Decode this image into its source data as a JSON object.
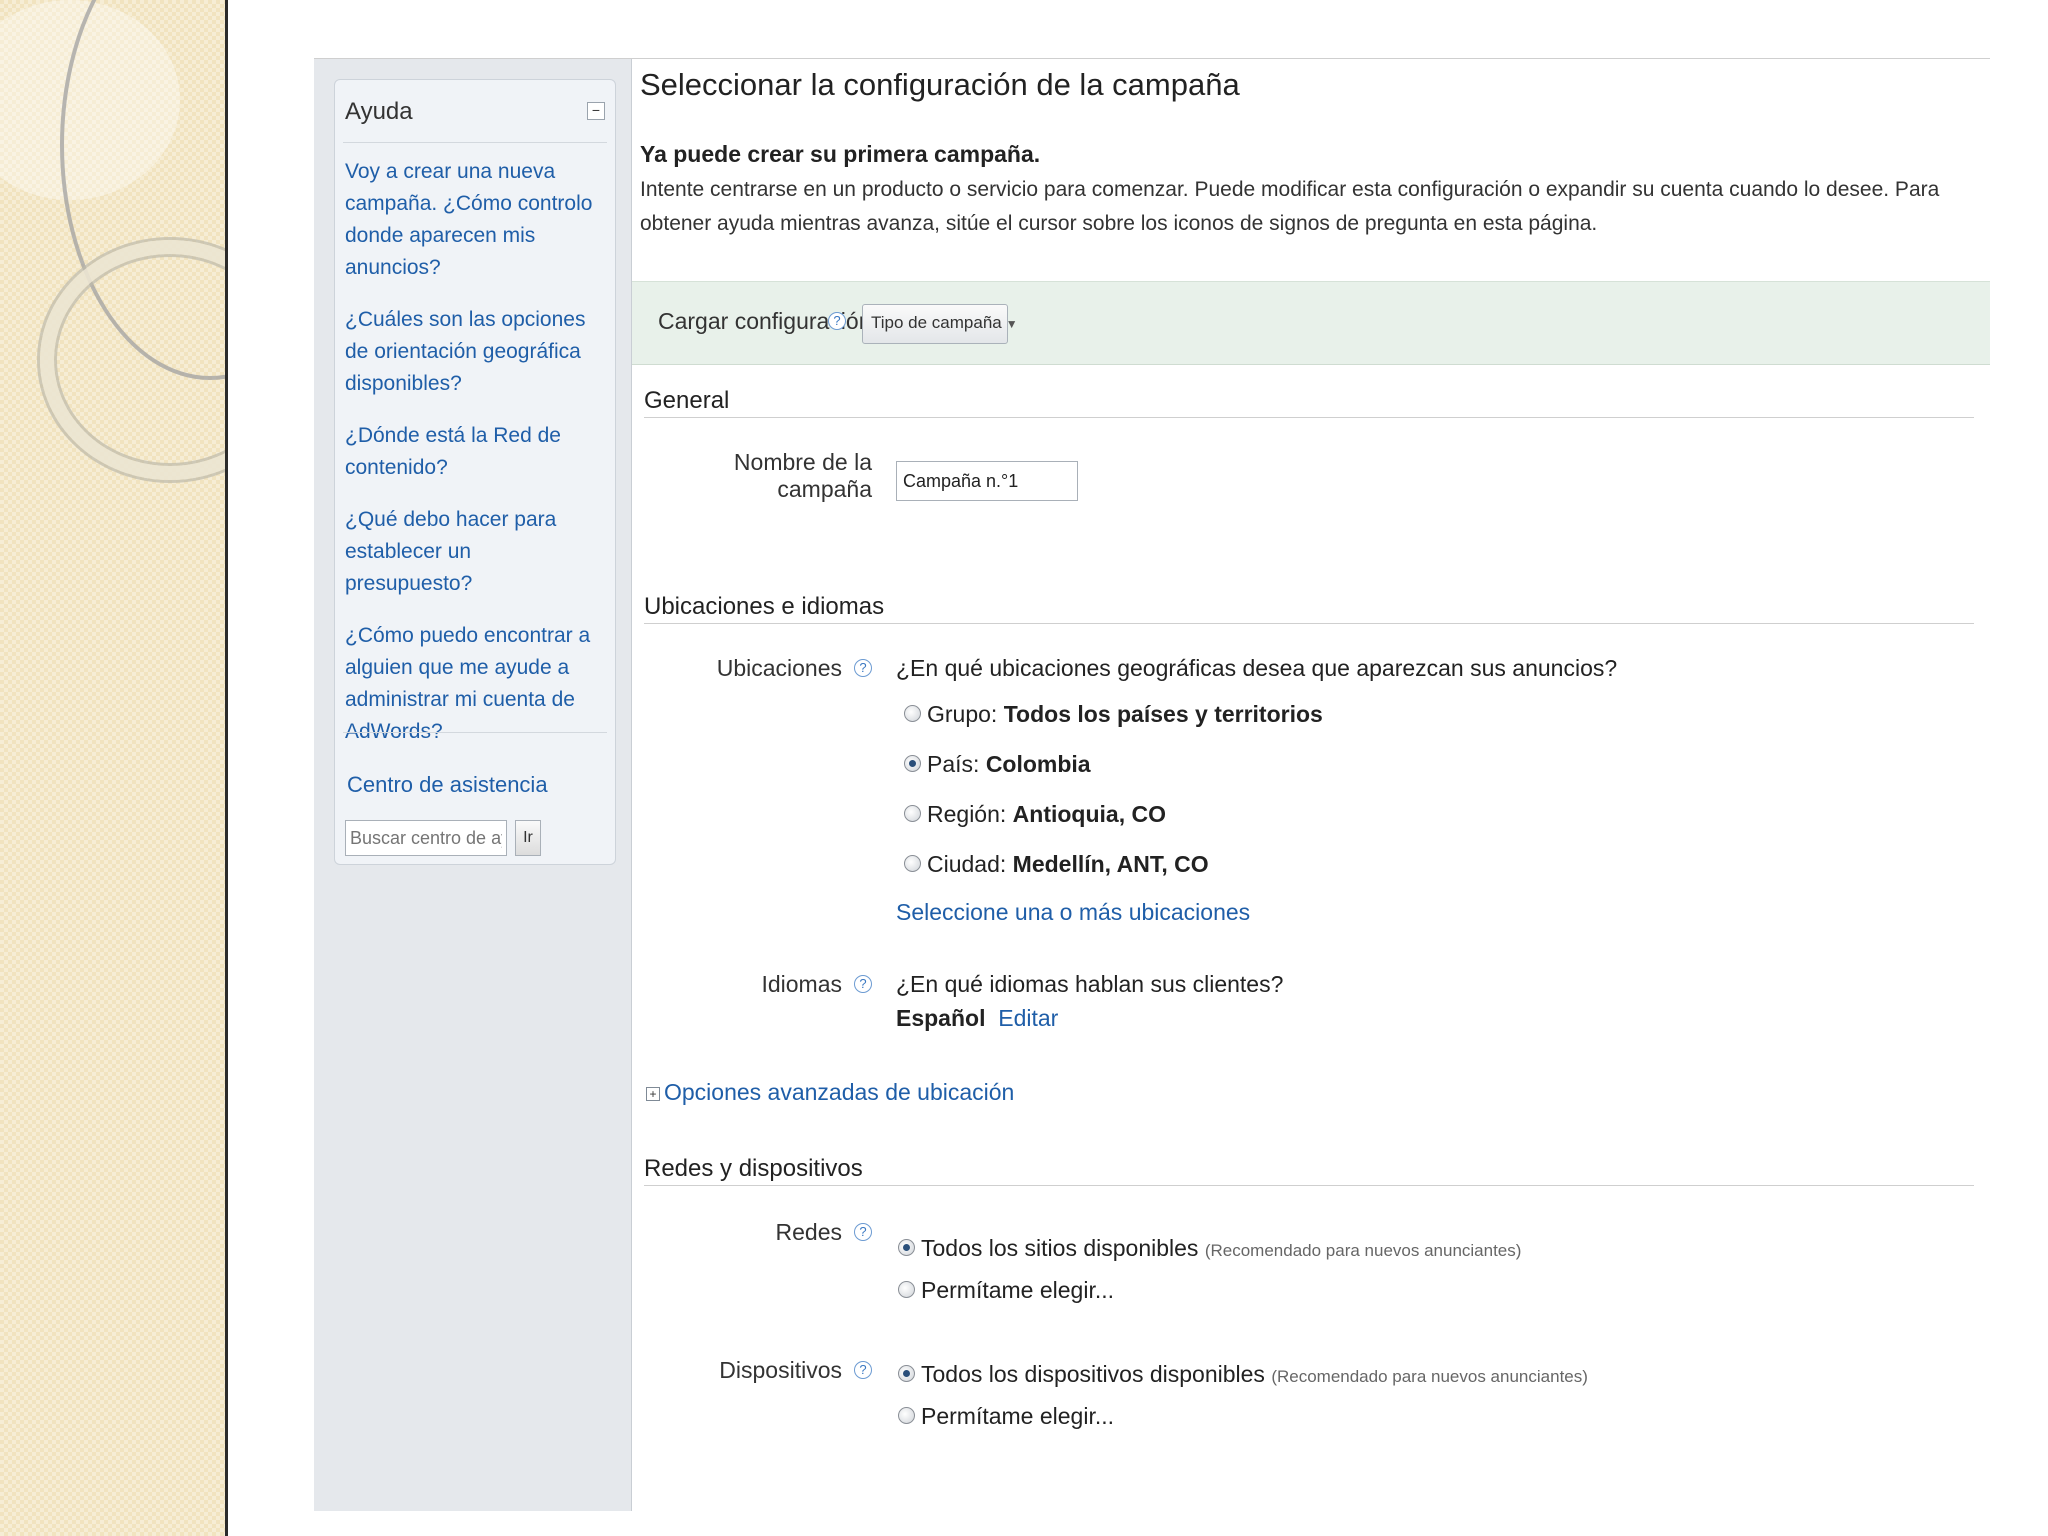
{
  "help": {
    "title": "Ayuda",
    "collapse_symbol": "−",
    "links": [
      "Voy a crear una nueva campaña. ¿Cómo controlo donde aparecen mis anuncios?",
      "¿Cuáles son las opciones de orientación geográfica disponibles?",
      "¿Dónde está la Red de contenido?",
      "¿Qué debo hacer para establecer un presupuesto?",
      "¿Cómo puedo encontrar a alguien que me ayude a administrar mi cuenta de AdWords?"
    ],
    "center_link": "Centro de asistencia",
    "search_placeholder": "Buscar centro de ayuda",
    "go_label": "Ir"
  },
  "page": {
    "title": "Seleccionar la configuración de la campaña",
    "intro_heading": "Ya puede crear su primera campaña.",
    "intro_text": "Intente centrarse en un producto o servicio para comenzar. Puede modificar esta configuración o expandir su cuenta cuando lo desee. Para obtener ayuda mientras avanza, sitúe el cursor sobre los iconos de signos de pregunta en esta página."
  },
  "load": {
    "label": "Cargar configuración",
    "dropdown": "Tipo de campaña"
  },
  "general": {
    "heading": "General",
    "name_label": "Nombre de la campaña",
    "name_value": "Campaña n.°1"
  },
  "locations": {
    "heading": "Ubicaciones e idiomas",
    "label": "Ubicaciones",
    "question": "¿En qué ubicaciones geográficas desea que aparezcan sus anuncios?",
    "options": [
      {
        "prefix": "Grupo:",
        "value": "Todos los países y territorios",
        "selected": false
      },
      {
        "prefix": "País:",
        "value": "Colombia",
        "selected": true
      },
      {
        "prefix": "Región:",
        "value": "Antioquia, CO",
        "selected": false
      },
      {
        "prefix": "Ciudad:",
        "value": "Medellín, ANT, CO",
        "selected": false
      }
    ],
    "select_link": "Seleccione una o más ubicaciones",
    "languages_label": "Idiomas",
    "languages_question": "¿En qué idiomas hablan sus clientes?",
    "language_value": "Español",
    "edit_link": "Editar",
    "advanced_link": "Opciones avanzadas de ubicación",
    "expand_symbol": "+"
  },
  "networks": {
    "heading": "Redes y dispositivos",
    "networks_label": "Redes",
    "networks_all": "Todos los sitios disponibles",
    "networks_note": "(Recomendado para nuevos anunciantes)",
    "networks_choose": "Permítame elegir...",
    "devices_label": "Dispositivos",
    "devices_all": "Todos los dispositivos disponibles",
    "devices_note": "(Recomendado para nuevos anunciantes)",
    "devices_choose": "Permítame elegir..."
  },
  "icons": {
    "help_question": "?"
  }
}
